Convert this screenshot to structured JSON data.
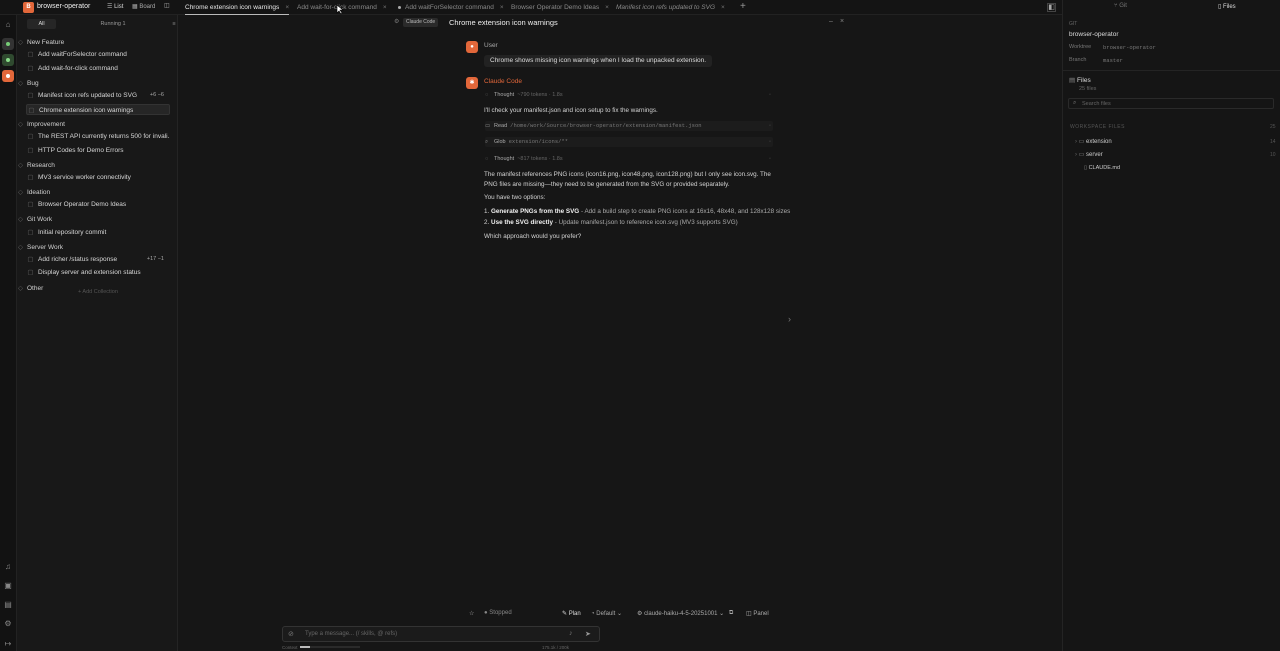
{
  "app": {
    "name": "browser-operator",
    "logo_glyph": "B",
    "accent": "#e2673a"
  },
  "views": {
    "list": "List",
    "board": "Board"
  },
  "tabs": [
    {
      "label": "Chrome extension icon warnings",
      "active": true
    },
    {
      "label": "Add wait-for-click command"
    },
    {
      "label": "Add waitForSelector command",
      "dot": true
    },
    {
      "label": "Browser Operator Demo Ideas"
    },
    {
      "label": "Manifest icon refs updated to SVG",
      "italic": true
    }
  ],
  "sidebar": {
    "filters": {
      "all": "All",
      "running": "Running 1"
    },
    "groups": [
      {
        "name": "New Feature",
        "items": [
          {
            "label": "Add waitForSelector command"
          },
          {
            "label": "Add wait-for-click command"
          }
        ]
      },
      {
        "name": "Bug",
        "items": [
          {
            "label": "Manifest icon refs updated to SVG",
            "diff": "+6 −6"
          },
          {
            "label": "Chrome extension icon warnings",
            "selected": true
          }
        ]
      },
      {
        "name": "Improvement",
        "items": [
          {
            "label": "The REST API currently returns 500 for invali..."
          },
          {
            "label": "HTTP Codes for Demo Errors"
          }
        ]
      },
      {
        "name": "Research",
        "items": [
          {
            "label": "MV3 service worker connectivity"
          }
        ]
      },
      {
        "name": "Ideation",
        "items": [
          {
            "label": "Browser Operator Demo Ideas"
          }
        ]
      },
      {
        "name": "Git Work",
        "items": [
          {
            "label": "Initial repository commit"
          }
        ]
      },
      {
        "name": "Server Work",
        "items": [
          {
            "label": "Add richer /status response",
            "diff": "+17 −1"
          },
          {
            "label": "Display server and extension status"
          }
        ]
      },
      {
        "name": "Other",
        "items": []
      }
    ],
    "add_collection": "+ Add Collection"
  },
  "main": {
    "badge": "Claude Code",
    "title": "Chrome extension icon warnings",
    "user_name": "User",
    "user_message": "Chrome shows missing icon warnings when I load the unpacked extension.",
    "assistant_name": "Claude Code",
    "thought1": {
      "label": "Thought",
      "meta": "~790 tokens · 1.8s"
    },
    "intro": "I'll check your manifest.json and icon setup to fix the warnings.",
    "read_tool": {
      "label": "Read",
      "arg": "/home/work/Source/browser-operator/extension/manifest.json"
    },
    "glob_tool": {
      "label": "Glob",
      "arg": "extension/icons/**"
    },
    "thought2": {
      "label": "Thought",
      "meta": "~817 tokens · 1.8s"
    },
    "para1": "The manifest references PNG icons (icon16.png, icon48.png, icon128.png) but I only see icon.svg. The PNG files are missing—they need to be generated from the SVG or provided separately.",
    "para2": "You have two options:",
    "opt1_num": "1.",
    "opt1_bold": "Generate PNGs from the SVG",
    "opt1_rest": " - Add a build step to create PNG icons at 16x16, 48x48, and 128x128 sizes",
    "opt2_num": "2.",
    "opt2_bold": "Use the SVG directly",
    "opt2_rest": " - Update manifest.json to reference icon.svg (MV3 supports SVG)",
    "para3": "Which approach would you prefer?"
  },
  "composer": {
    "status": "Stopped",
    "plan": "Plan",
    "mode": "Default",
    "model": "claude-haiku-4-5-20251001",
    "panel": "Panel",
    "placeholder": "Type a message... (/ skills, @ refs)",
    "context_label": "Context",
    "context_value": "175.1k / 200k",
    "context_fill": 0.17
  },
  "right": {
    "tab_git": "Git",
    "tab_files": "Files",
    "section": "GIT",
    "repo": "browser-operator",
    "worktree_k": "Worktree",
    "worktree_v": "browser-operator",
    "branch_k": "Branch",
    "branch_v": "master",
    "files_title": "Files",
    "files_count": "25 files",
    "search_placeholder": "Search files",
    "ws_label": "WORKSPACE FILES",
    "ws_count": "25",
    "tree": [
      {
        "name": "extension",
        "count": "14"
      },
      {
        "name": "server",
        "count": "10"
      },
      {
        "name": "CLAUDE.md"
      }
    ]
  }
}
